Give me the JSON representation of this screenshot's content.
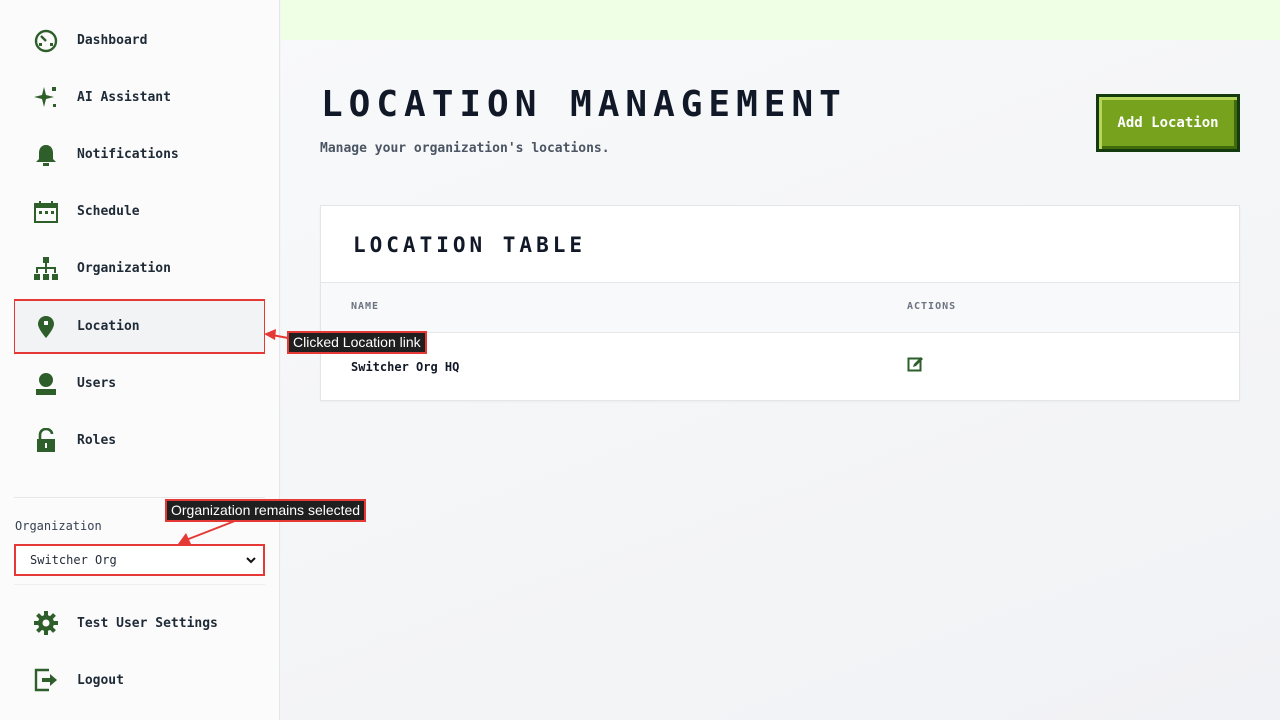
{
  "sidebar": {
    "items": [
      {
        "label": "Dashboard",
        "icon": "dashboard-icon"
      },
      {
        "label": "AI Assistant",
        "icon": "sparkle-icon"
      },
      {
        "label": "Notifications",
        "icon": "bell-icon"
      },
      {
        "label": "Schedule",
        "icon": "calendar-icon"
      },
      {
        "label": "Organization",
        "icon": "org-chart-icon"
      },
      {
        "label": "Location",
        "icon": "map-pin-icon",
        "active": true
      },
      {
        "label": "Users",
        "icon": "user-icon"
      },
      {
        "label": "Roles",
        "icon": "lock-icon"
      }
    ],
    "org_label": "Organization",
    "org_selected": "Switcher Org",
    "bottom": [
      {
        "label": "Test User Settings",
        "icon": "gear-icon"
      },
      {
        "label": "Logout",
        "icon": "logout-icon"
      }
    ]
  },
  "main": {
    "title": "LOCATION MANAGEMENT",
    "subtitle": "Manage your organization's locations.",
    "add_button": "Add Location",
    "table": {
      "title": "LOCATION TABLE",
      "headers": [
        "NAME",
        "ACTIONS"
      ],
      "rows": [
        {
          "name": "Switcher Org HQ"
        }
      ]
    }
  },
  "annotations": {
    "location_note": "Clicked Location link",
    "org_note": "Organization remains selected"
  },
  "colors": {
    "accent_green": "#76a21e",
    "icon_green": "#2e5e2a",
    "highlight_red": "#e53935",
    "topbar": "#efffe6"
  }
}
